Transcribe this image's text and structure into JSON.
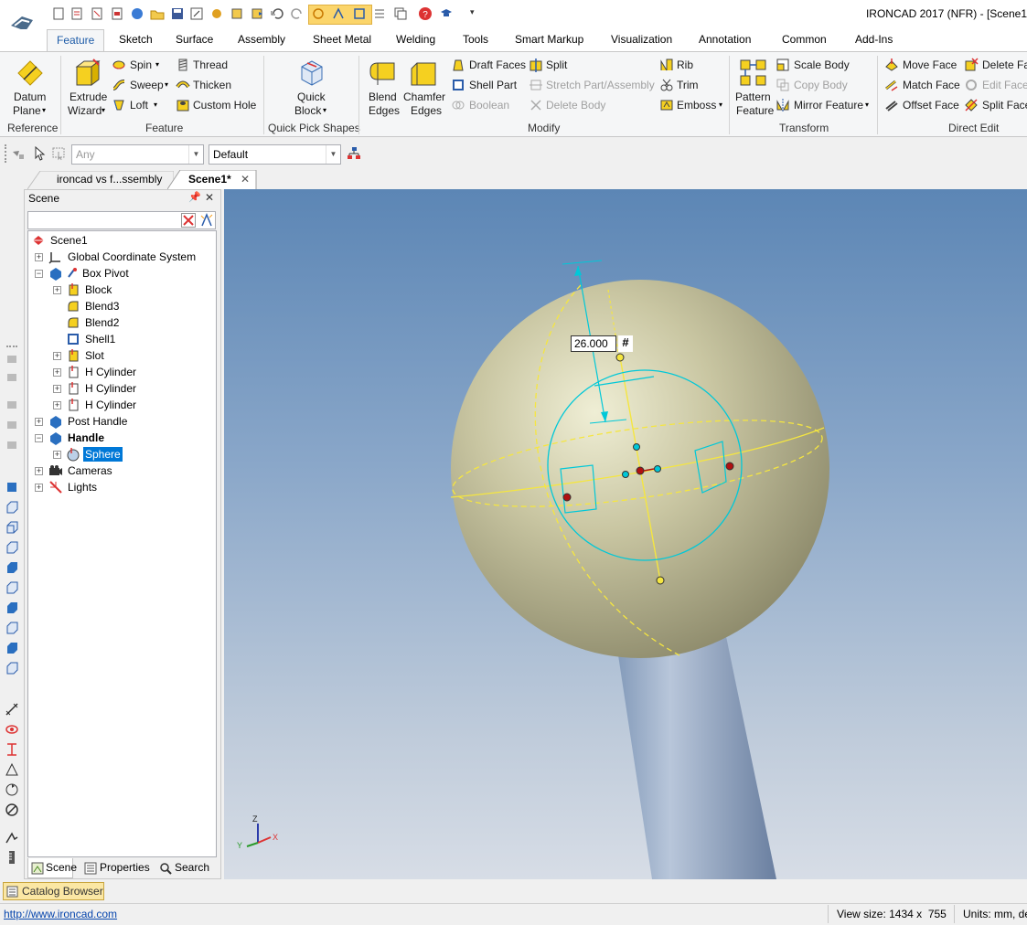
{
  "window": {
    "title": "IRONCAD 2017 (NFR) - [Scene1"
  },
  "ribbon_tabs": [
    "Feature",
    "Sketch",
    "Surface",
    "Assembly",
    "Sheet Metal",
    "Welding",
    "Tools",
    "Smart Markup",
    "Visualization",
    "Annotation",
    "Common",
    "Add-Ins"
  ],
  "ribbon": {
    "reference": {
      "datum_plane_1": "Datum",
      "datum_plane_2": "Plane",
      "group": "Reference"
    },
    "feature": {
      "extrude_1": "Extrude",
      "extrude_2": "Wizard",
      "spin": "Spin",
      "sweep": "Sweep",
      "loft": "Loft",
      "thread": "Thread",
      "thicken": "Thicken",
      "custom_hole": "Custom Hole",
      "group": "Feature"
    },
    "quick_pick": {
      "quick_block_1": "Quick",
      "quick_block_2": "Block",
      "group": "Quick Pick Shapes"
    },
    "modify": {
      "blend_1": "Blend",
      "blend_2": "Edges",
      "chamfer_1": "Chamfer",
      "chamfer_2": "Edges",
      "draft_faces": "Draft Faces",
      "shell_part": "Shell Part",
      "boolean": "Boolean",
      "split": "Split",
      "stretch": "Stretch Part/Assembly",
      "delete_body": "Delete Body",
      "rib": "Rib",
      "trim": "Trim",
      "emboss": "Emboss",
      "group": "Modify"
    },
    "transform": {
      "pattern_1": "Pattern",
      "pattern_2": "Feature",
      "scale_body": "Scale Body",
      "copy_body": "Copy Body",
      "mirror_feature": "Mirror Feature",
      "group": "Transform"
    },
    "direct_edit": {
      "move_face": "Move Face",
      "match_face": "Match Face",
      "offset_face": "Offset Face",
      "delete_face": "Delete Fa",
      "edit_face": "Edit Face",
      "split_face": "Split Face",
      "group": "Direct Edit"
    }
  },
  "selection": {
    "filter": "Any",
    "style": "Default"
  },
  "doc_tabs": [
    "ironcad vs f...ssembly",
    "Scene1*"
  ],
  "scene_panel": {
    "title": "Scene",
    "tree": [
      {
        "label": "Scene1"
      },
      {
        "label": "Global Coordinate System"
      },
      {
        "label": "Box Pivot"
      },
      {
        "label": "Block"
      },
      {
        "label": "Blend3"
      },
      {
        "label": "Blend2"
      },
      {
        "label": "Shell1"
      },
      {
        "label": "Slot"
      },
      {
        "label": "H Cylinder"
      },
      {
        "label": "H Cylinder"
      },
      {
        "label": "H Cylinder"
      },
      {
        "label": "Post Handle"
      },
      {
        "label": "Handle"
      },
      {
        "label": "Sphere"
      },
      {
        "label": "Cameras"
      },
      {
        "label": "Lights"
      }
    ],
    "bottom_tabs": [
      "Scene",
      "Properties",
      "Search"
    ]
  },
  "viewport": {
    "dimension_value": "26.000",
    "dimension_symbol": "#",
    "axis": {
      "z": "Z",
      "x": "X",
      "y": "Y"
    }
  },
  "catalog": {
    "label": "Catalog Browser"
  },
  "status": {
    "url": "http://www.ironcad.com",
    "view_size": "View size: 1434 x  755",
    "units": "Units: mm, de"
  },
  "colors": {
    "accent": "#1e5ca8",
    "selection": "#0078d7",
    "viewport_top": "#5c86b5",
    "sphere": "#c8c6a4",
    "cyan": "#00c8d8",
    "yellow": "#f5e640"
  }
}
